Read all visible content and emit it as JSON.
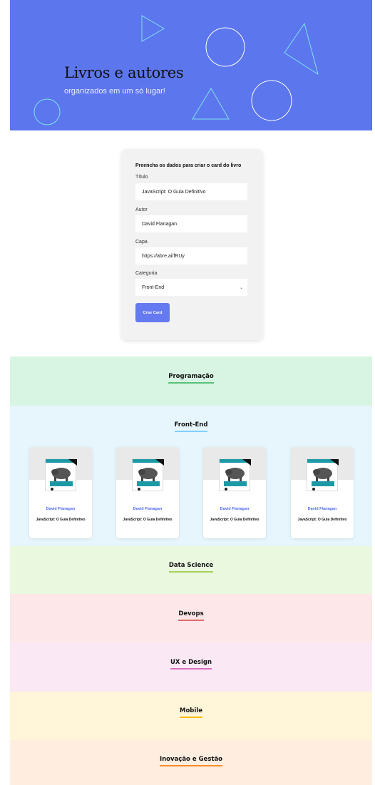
{
  "banner": {
    "title": "Livros e autores",
    "subtitle": "organizados em um só lugar!",
    "bg_color": "#5c76ee"
  },
  "form": {
    "heading": "Preencha os dados para criar o card do livro",
    "title_label": "Título",
    "title_value": "JavaScript: O Guia Definitivo",
    "author_label": "Autor",
    "author_value": "David Flanagan",
    "cover_label": "Capa",
    "cover_value": "https://abre.ai/fRUy",
    "category_label": "Categoria",
    "category_value": "Front-End",
    "submit_label": "Criar Card",
    "accent_color": "#6579f0"
  },
  "sections": [
    {
      "name": "Programação",
      "bg": "#d8f5e3",
      "underline": "#57c278"
    },
    {
      "name": "Front-End",
      "bg": "#e6f6fc",
      "underline": "#82cffa"
    },
    {
      "name": "Data Science",
      "bg": "#eaf8e0",
      "underline": "#a6d157"
    },
    {
      "name": "Devops",
      "bg": "#fde7e8",
      "underline": "#e06b69"
    },
    {
      "name": "UX e Design",
      "bg": "#fae9f5",
      "underline": "#db6ebf"
    },
    {
      "name": "Mobile",
      "bg": "#fff5d9",
      "underline": "#ffba05"
    },
    {
      "name": "Inovação e Gestão",
      "bg": "#ffeedf",
      "underline": "#ff8a29"
    }
  ],
  "books": [
    {
      "author": "David Flanagan",
      "title": "JavaScript: O Guia Definitivo"
    },
    {
      "author": "David Flanagan",
      "title": "JavaScript: O Guia Definitivo"
    },
    {
      "author": "David Flanagan",
      "title": "JavaScript: O Guia Definitivo"
    },
    {
      "author": "David Flanagan",
      "title": "JavaScript: O Guia Definitivo"
    }
  ]
}
